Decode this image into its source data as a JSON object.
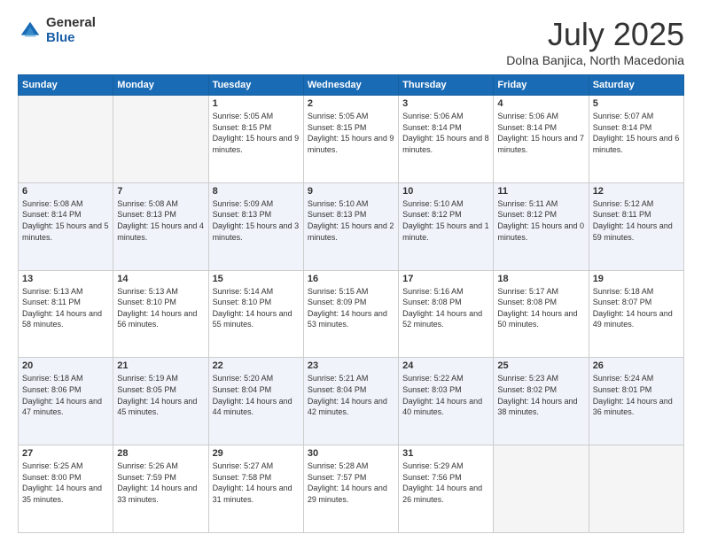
{
  "logo": {
    "general": "General",
    "blue": "Blue"
  },
  "header": {
    "title": "July 2025",
    "subtitle": "Dolna Banjica, North Macedonia"
  },
  "weekdays": [
    "Sunday",
    "Monday",
    "Tuesday",
    "Wednesday",
    "Thursday",
    "Friday",
    "Saturday"
  ],
  "weeks": [
    [
      {
        "day": null,
        "empty": true
      },
      {
        "day": null,
        "empty": true
      },
      {
        "day": 1,
        "sunrise": "5:05 AM",
        "sunset": "8:15 PM",
        "daylight": "15 hours and 9 minutes."
      },
      {
        "day": 2,
        "sunrise": "5:05 AM",
        "sunset": "8:15 PM",
        "daylight": "15 hours and 9 minutes."
      },
      {
        "day": 3,
        "sunrise": "5:06 AM",
        "sunset": "8:14 PM",
        "daylight": "15 hours and 8 minutes."
      },
      {
        "day": 4,
        "sunrise": "5:06 AM",
        "sunset": "8:14 PM",
        "daylight": "15 hours and 7 minutes."
      },
      {
        "day": 5,
        "sunrise": "5:07 AM",
        "sunset": "8:14 PM",
        "daylight": "15 hours and 6 minutes."
      }
    ],
    [
      {
        "day": 6,
        "sunrise": "5:08 AM",
        "sunset": "8:14 PM",
        "daylight": "15 hours and 5 minutes."
      },
      {
        "day": 7,
        "sunrise": "5:08 AM",
        "sunset": "8:13 PM",
        "daylight": "15 hours and 4 minutes."
      },
      {
        "day": 8,
        "sunrise": "5:09 AM",
        "sunset": "8:13 PM",
        "daylight": "15 hours and 3 minutes."
      },
      {
        "day": 9,
        "sunrise": "5:10 AM",
        "sunset": "8:13 PM",
        "daylight": "15 hours and 2 minutes."
      },
      {
        "day": 10,
        "sunrise": "5:10 AM",
        "sunset": "8:12 PM",
        "daylight": "15 hours and 1 minute."
      },
      {
        "day": 11,
        "sunrise": "5:11 AM",
        "sunset": "8:12 PM",
        "daylight": "15 hours and 0 minutes."
      },
      {
        "day": 12,
        "sunrise": "5:12 AM",
        "sunset": "8:11 PM",
        "daylight": "14 hours and 59 minutes."
      }
    ],
    [
      {
        "day": 13,
        "sunrise": "5:13 AM",
        "sunset": "8:11 PM",
        "daylight": "14 hours and 58 minutes."
      },
      {
        "day": 14,
        "sunrise": "5:13 AM",
        "sunset": "8:10 PM",
        "daylight": "14 hours and 56 minutes."
      },
      {
        "day": 15,
        "sunrise": "5:14 AM",
        "sunset": "8:10 PM",
        "daylight": "14 hours and 55 minutes."
      },
      {
        "day": 16,
        "sunrise": "5:15 AM",
        "sunset": "8:09 PM",
        "daylight": "14 hours and 53 minutes."
      },
      {
        "day": 17,
        "sunrise": "5:16 AM",
        "sunset": "8:08 PM",
        "daylight": "14 hours and 52 minutes."
      },
      {
        "day": 18,
        "sunrise": "5:17 AM",
        "sunset": "8:08 PM",
        "daylight": "14 hours and 50 minutes."
      },
      {
        "day": 19,
        "sunrise": "5:18 AM",
        "sunset": "8:07 PM",
        "daylight": "14 hours and 49 minutes."
      }
    ],
    [
      {
        "day": 20,
        "sunrise": "5:18 AM",
        "sunset": "8:06 PM",
        "daylight": "14 hours and 47 minutes."
      },
      {
        "day": 21,
        "sunrise": "5:19 AM",
        "sunset": "8:05 PM",
        "daylight": "14 hours and 45 minutes."
      },
      {
        "day": 22,
        "sunrise": "5:20 AM",
        "sunset": "8:04 PM",
        "daylight": "14 hours and 44 minutes."
      },
      {
        "day": 23,
        "sunrise": "5:21 AM",
        "sunset": "8:04 PM",
        "daylight": "14 hours and 42 minutes."
      },
      {
        "day": 24,
        "sunrise": "5:22 AM",
        "sunset": "8:03 PM",
        "daylight": "14 hours and 40 minutes."
      },
      {
        "day": 25,
        "sunrise": "5:23 AM",
        "sunset": "8:02 PM",
        "daylight": "14 hours and 38 minutes."
      },
      {
        "day": 26,
        "sunrise": "5:24 AM",
        "sunset": "8:01 PM",
        "daylight": "14 hours and 36 minutes."
      }
    ],
    [
      {
        "day": 27,
        "sunrise": "5:25 AM",
        "sunset": "8:00 PM",
        "daylight": "14 hours and 35 minutes."
      },
      {
        "day": 28,
        "sunrise": "5:26 AM",
        "sunset": "7:59 PM",
        "daylight": "14 hours and 33 minutes."
      },
      {
        "day": 29,
        "sunrise": "5:27 AM",
        "sunset": "7:58 PM",
        "daylight": "14 hours and 31 minutes."
      },
      {
        "day": 30,
        "sunrise": "5:28 AM",
        "sunset": "7:57 PM",
        "daylight": "14 hours and 29 minutes."
      },
      {
        "day": 31,
        "sunrise": "5:29 AM",
        "sunset": "7:56 PM",
        "daylight": "14 hours and 26 minutes."
      },
      {
        "day": null,
        "empty": true
      },
      {
        "day": null,
        "empty": true
      }
    ]
  ]
}
